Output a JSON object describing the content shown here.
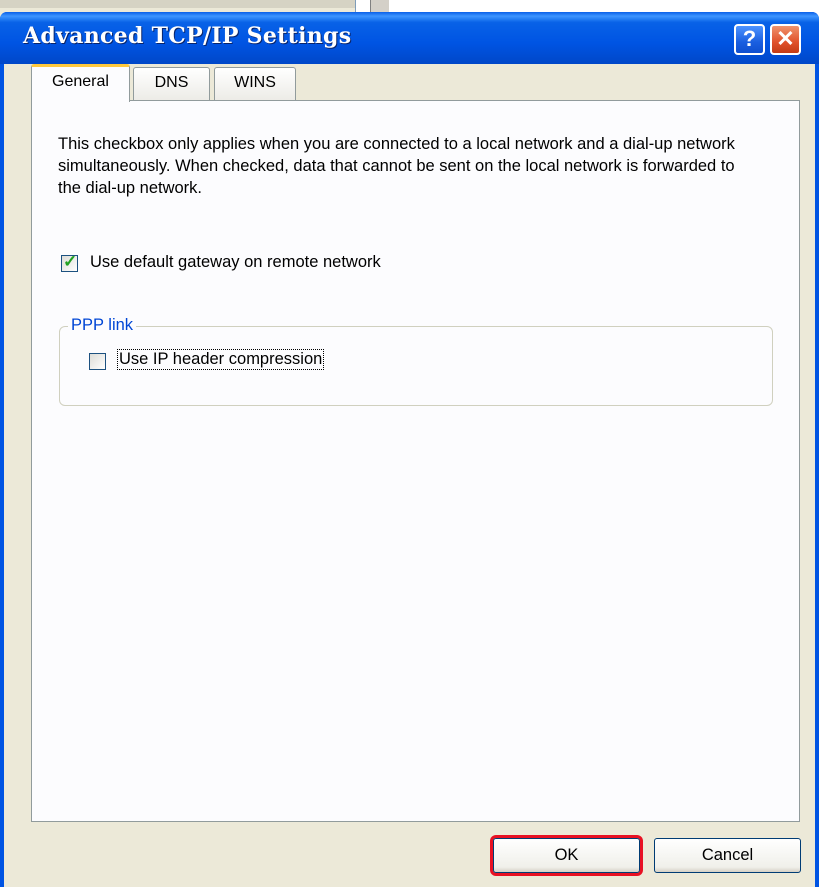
{
  "dialog": {
    "title": "Advanced TCP/IP Settings",
    "help_glyph": "?",
    "close_glyph": "✕"
  },
  "tabs": [
    {
      "label": "General",
      "active": true
    },
    {
      "label": "DNS",
      "active": false
    },
    {
      "label": "WINS",
      "active": false
    }
  ],
  "general": {
    "description": "This checkbox only applies when you are connected to a local network and a dial-up network simultaneously.  When checked, data that cannot be sent on the local network is forwarded to the dial-up network.",
    "default_gateway": {
      "label": "Use default gateway on remote network",
      "checked": true
    },
    "ppp_group": {
      "title": "PPP link",
      "ip_header_compression": {
        "label": "Use IP header compression",
        "checked": false
      }
    }
  },
  "buttons": {
    "ok": "OK",
    "cancel": "Cancel"
  },
  "colors": {
    "titlebar": "#0054e3",
    "ok_highlight": "#e81123",
    "group_title": "#0046d5",
    "check": "#21a121"
  }
}
